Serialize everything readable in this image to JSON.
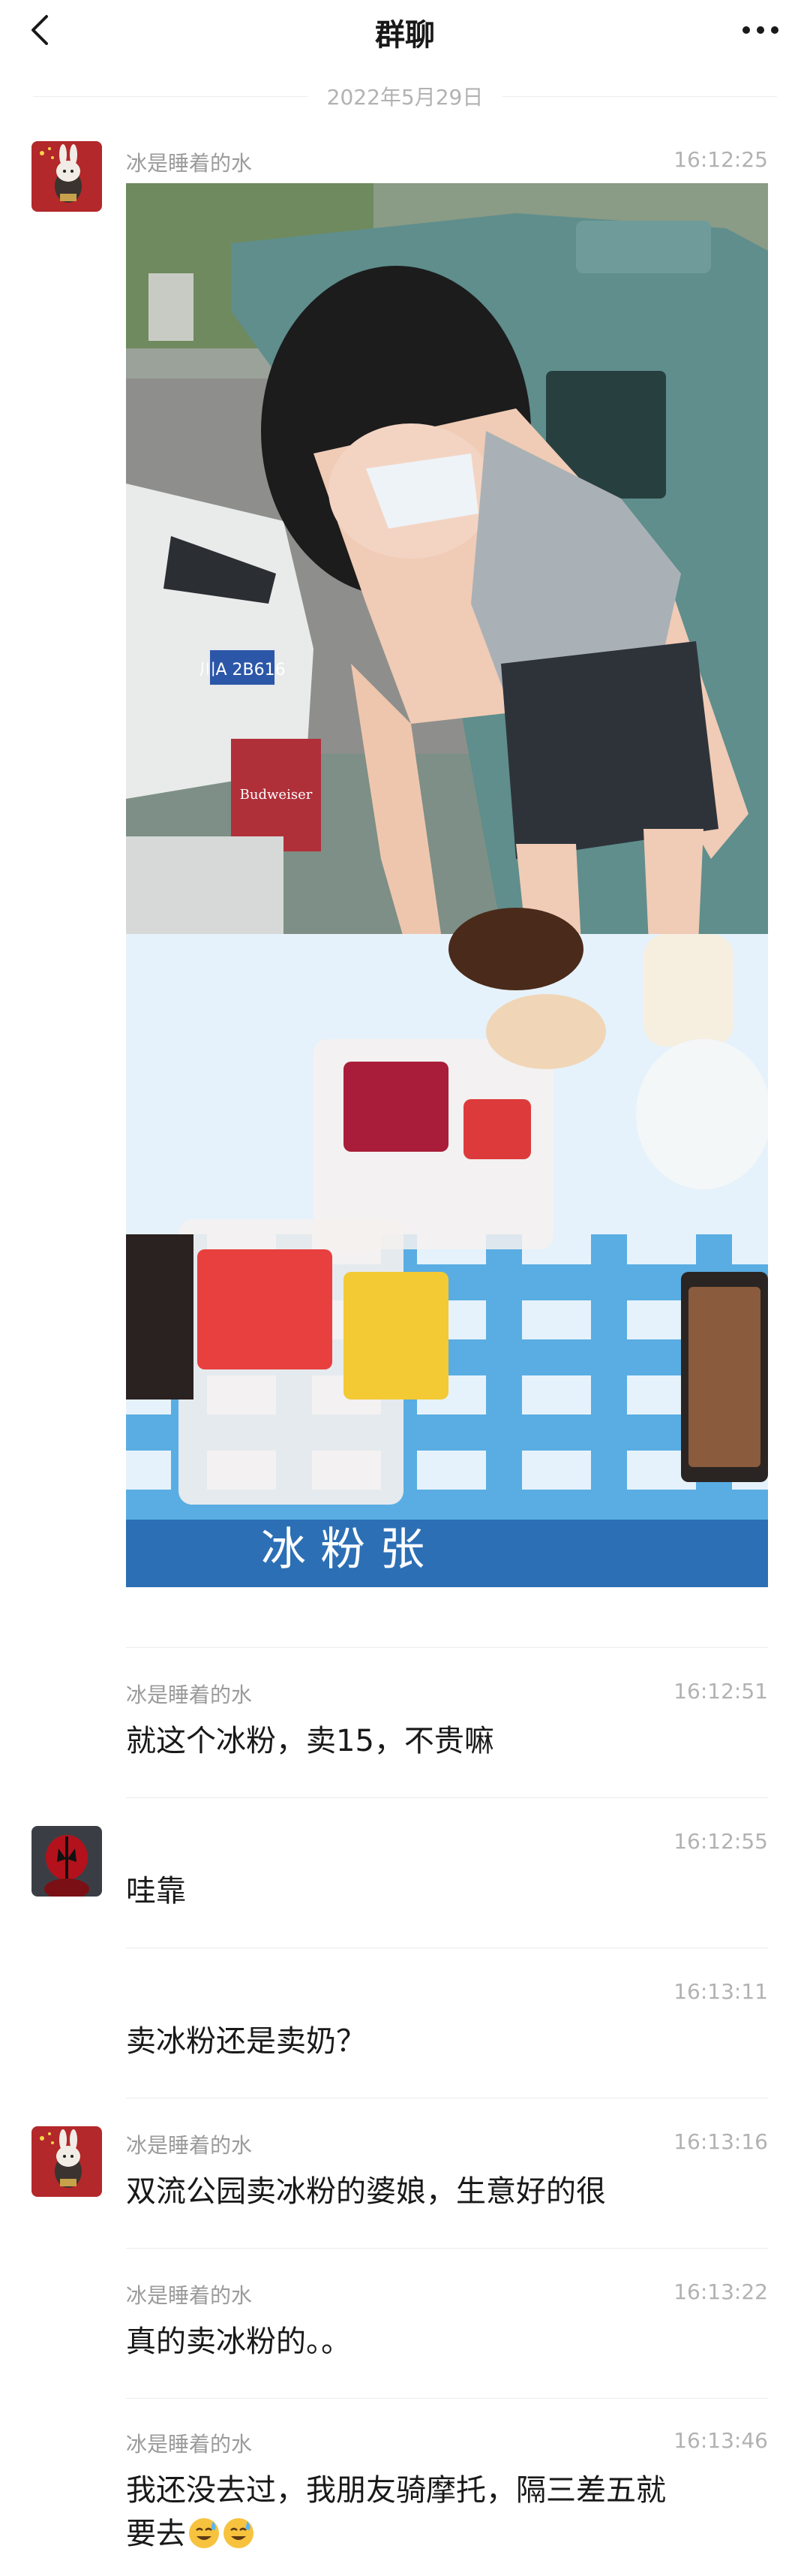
{
  "header": {
    "title": "群聊",
    "back_icon": "chevron-left-icon",
    "more_icon": "more-dots-icon"
  },
  "date_separator": "2022年5月29日",
  "messages": [
    {
      "sender": "冰是睡着的水",
      "time": "16:12:25",
      "type": "image",
      "avatar": "rabbit-avatar"
    },
    {
      "sender": "冰是睡着的水",
      "time": "16:12:51",
      "type": "text",
      "text": "就这个冰粉，卖15，不贵嘛"
    },
    {
      "sender": "",
      "time": "16:12:55",
      "type": "text",
      "text": "哇靠",
      "avatar": "deadpool-avatar"
    },
    {
      "sender": "",
      "time": "16:13:11",
      "type": "text",
      "text": "卖冰粉还是卖奶？"
    },
    {
      "sender": "冰是睡着的水",
      "time": "16:13:16",
      "type": "text",
      "text": "双流公园卖冰粉的婆娘，生意好的很",
      "avatar": "rabbit-avatar"
    },
    {
      "sender": "冰是睡着的水",
      "time": "16:13:22",
      "type": "text",
      "text": "真的卖冰粉的。。"
    },
    {
      "sender": "冰是睡着的水",
      "time": "16:13:46",
      "type": "text",
      "text_line1": "我还没去过，我朋友骑摩托，隔三差五就",
      "text_line2": "要去",
      "emojis": [
        "sweat-smile-emoji",
        "sweat-smile-emoji"
      ]
    }
  ],
  "photo": {
    "plate_text": "川A 2B616",
    "box_text": "Budweiser",
    "banner_text": "冰 粉 张"
  },
  "colors": {
    "accent_text": "#191919",
    "secondary_text": "#9b9b9b",
    "divider": "#ececec",
    "tablecloth_blue": "#4aa6e0"
  }
}
